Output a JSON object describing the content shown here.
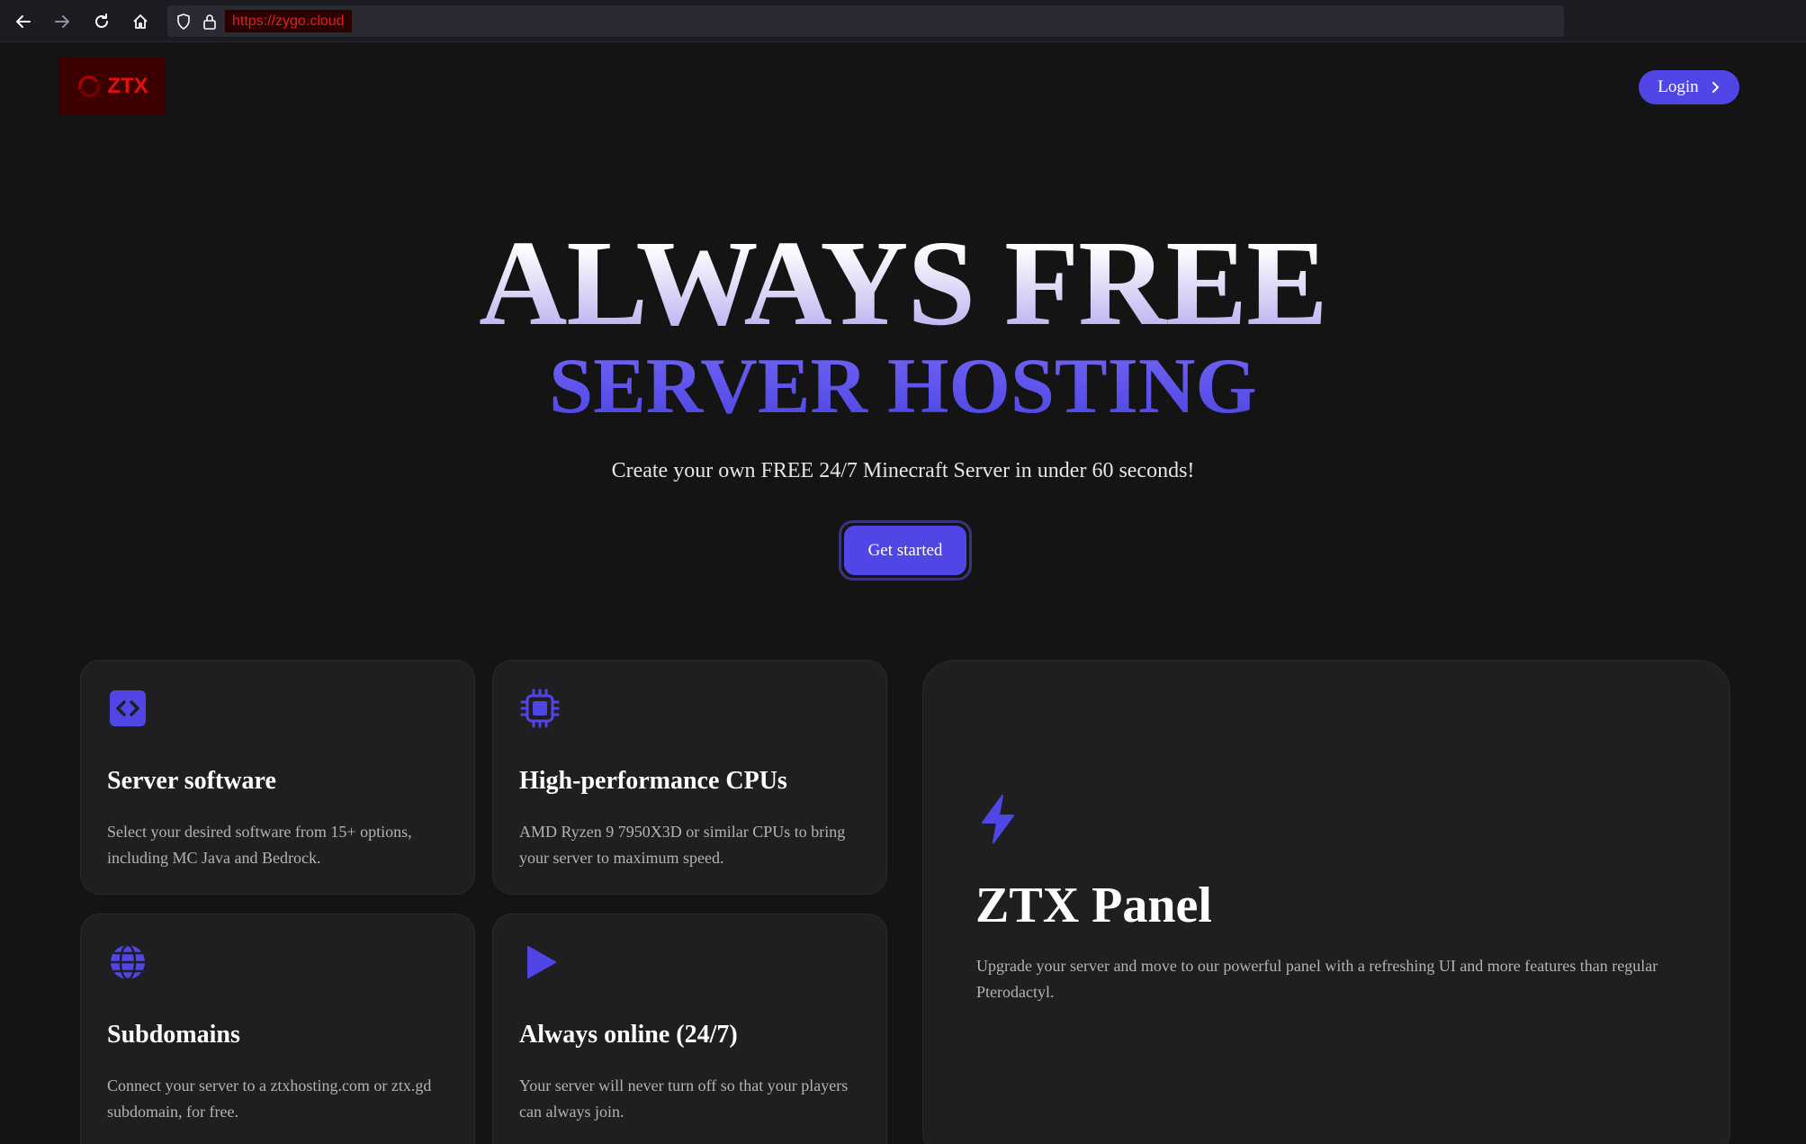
{
  "browser": {
    "url": "https://zygo.cloud"
  },
  "header": {
    "logo_text": "ZTX",
    "login_label": "Login"
  },
  "hero": {
    "title_line1": "ALWAYS FREE",
    "title_line2": "SERVER HOSTING",
    "subtitle": "Create your own FREE 24/7 Minecraft Server in under 60 seconds!",
    "cta_label": "Get started"
  },
  "features": [
    {
      "title": "Server software",
      "description": "Select your desired software from 15+ options, including MC Java and Bedrock.",
      "icon": "code-icon"
    },
    {
      "title": "High-performance CPUs",
      "description": "AMD Ryzen 9 7950X3D or similar CPUs to bring your server to maximum speed.",
      "icon": "cpu-icon"
    },
    {
      "title": "Subdomains",
      "description": "Connect your server to a ztxhosting.com or ztx.gd subdomain, for free.",
      "icon": "globe-icon"
    },
    {
      "title": "Always online (24/7)",
      "description": "Your server will never turn off so that your players can always join.",
      "icon": "play-icon"
    }
  ],
  "panel": {
    "title": "ZTX Panel",
    "description": "Upgrade your server and move to our powerful panel with a refreshing UI and more features than regular Pterodactyl.",
    "icon": "lightning-icon"
  },
  "colors": {
    "accent": "#4f46e5",
    "background": "#141414",
    "card": "#1f1f21",
    "logo_red": "#e01010"
  }
}
